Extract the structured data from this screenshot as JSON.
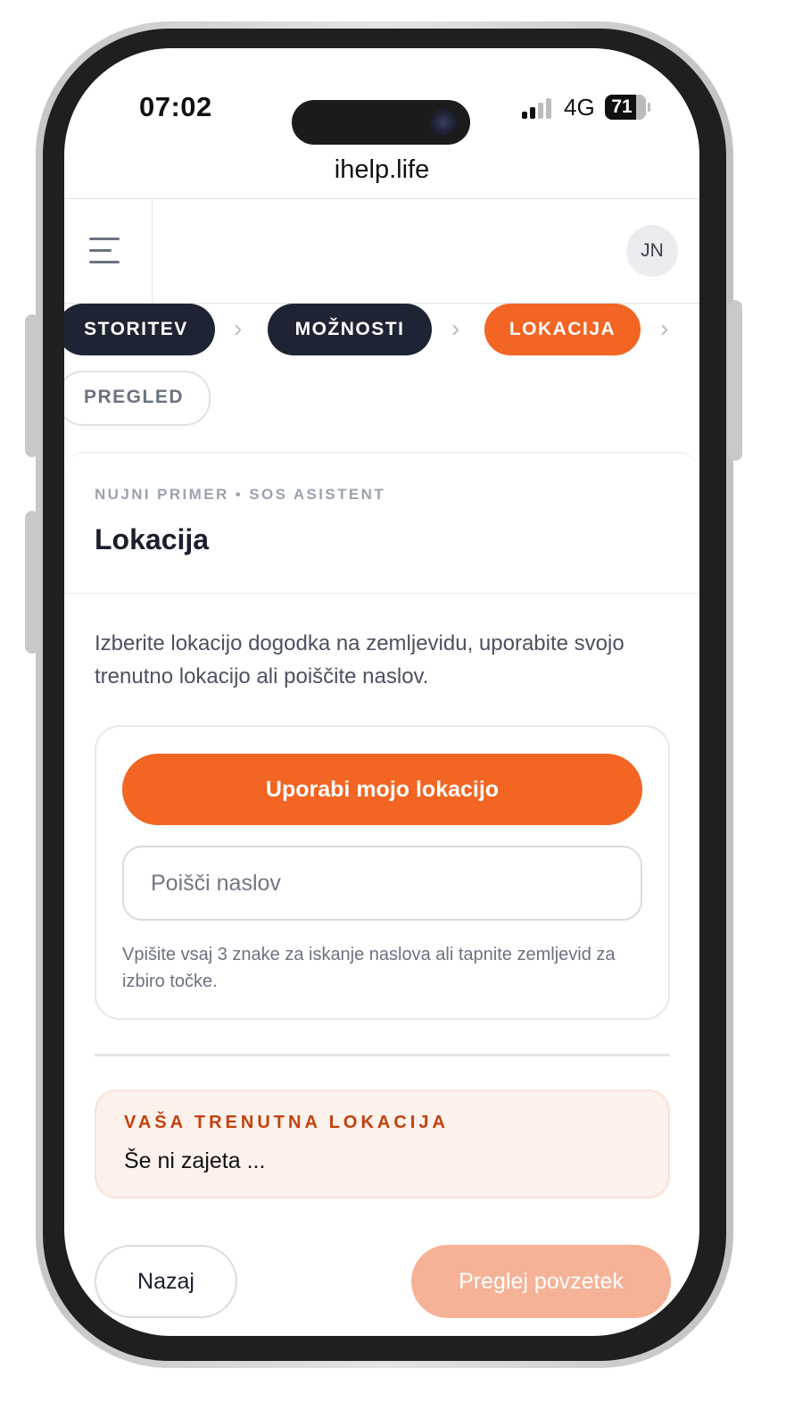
{
  "status_bar": {
    "time": "07:02",
    "network": "4G",
    "battery": "71",
    "signal_bars_filled": 2,
    "signal_bars_total": 4
  },
  "browser": {
    "url": "ihelp.life"
  },
  "header": {
    "menu_icon": "hamburger-menu-icon",
    "avatar_initials": "JN"
  },
  "steps": [
    {
      "label": "STORITEV",
      "state": "done"
    },
    {
      "label": "MOŽNOSTI",
      "state": "done"
    },
    {
      "label": "LOKACIJA",
      "state": "active"
    },
    {
      "label": "PREGLED",
      "state": "pending"
    }
  ],
  "step_separator_icon": "chevron-right-icon",
  "card": {
    "kicker": "NUJNI PRIMER • SOS ASISTENT",
    "title": "Lokacija",
    "intro": "Izberite lokacijo dogodka na zemljevidu, uporabite svojo trenutno lokacijo ali poiščite naslov."
  },
  "location": {
    "use_location_label": "Uporabi mojo lokacijo",
    "search_placeholder": "Poišči naslov",
    "search_value": "",
    "hint": "Vpišite vsaj 3 znake za iskanje naslova ali tapnite zemljevid za izbiro točke."
  },
  "current_location": {
    "label": "VAŠA TRENUTNA LOKACIJA",
    "value": "Še ni zajeta ..."
  },
  "footer": {
    "back_label": "Nazaj",
    "summary_label": "Preglej povzetek"
  },
  "colors": {
    "accent": "#f26522",
    "accent_disabled": "#f6b296",
    "step_done": "#1e2433",
    "current_location_bg": "#fdf1ec",
    "current_location_label": "#c2410c"
  }
}
